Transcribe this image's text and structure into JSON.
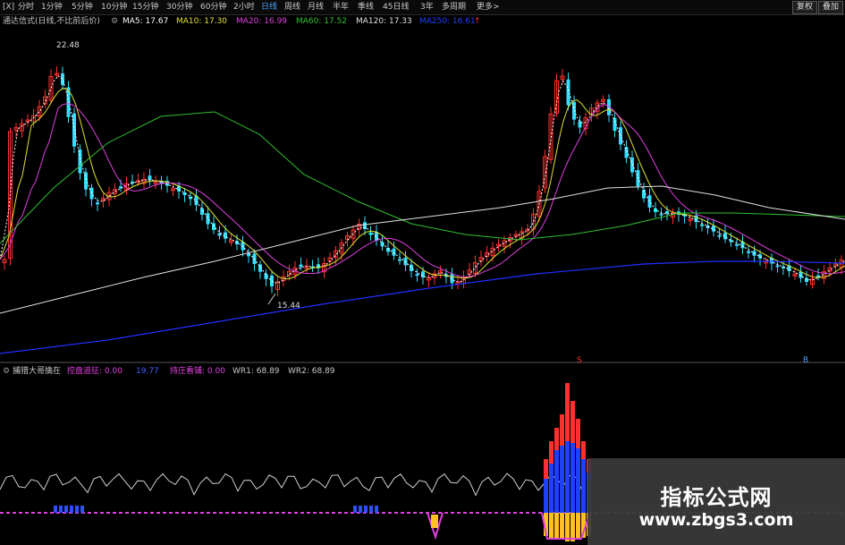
{
  "toolbar": {
    "tabs": [
      "[X]",
      "分时",
      "1分钟",
      "5分钟",
      "10分钟",
      "15分钟",
      "30分钟",
      "60分钟",
      "2小时",
      "日线",
      "周线",
      "月线",
      "半年",
      "季线",
      "45日线",
      "3年",
      "多周期",
      "更多>"
    ],
    "active_index": 9,
    "btn_restore": "复权",
    "btn_overlay": "叠加"
  },
  "ma_row": {
    "stock_name": "通达信式(日线,不比前后价)",
    "ma5": "MA5: 17.67",
    "ma10": "MA10: 17.30",
    "ma20": "MA20: 16.99",
    "ma60": "MA60: 17.52",
    "ma120": "MA120: 17.33",
    "ma250": "MA250: 16.61"
  },
  "annotations": {
    "high": "22.48",
    "low": "15.44",
    "mark_S": "S",
    "mark_B": "B"
  },
  "indicator_row": {
    "name": "捕猎大哥擒在",
    "v1": "控盘追征: 0.00",
    "v2": "19.77",
    "v3": "持庄看铺: 0.00",
    "v4": "WR1: 68.89",
    "v5": "WR2: 68.89"
  },
  "watermark": {
    "title": "指标公式网",
    "url": "www.zbgs3.com"
  },
  "colors": {
    "up": "#ff3030",
    "down": "#30e0ff",
    "ma5": "#ffffff",
    "ma10": "#e0e030",
    "ma20": "#e040e0",
    "ma60": "#30c030",
    "ma120": "#e0e0e0",
    "ma250": "#2030ff"
  }
}
